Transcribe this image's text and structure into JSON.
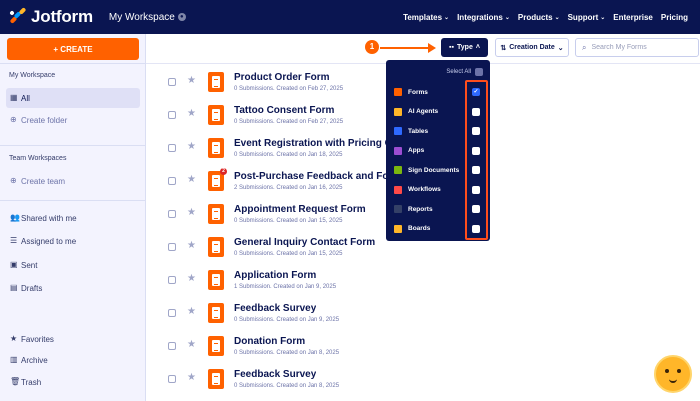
{
  "header": {
    "logo_text": "Jotform",
    "workspace_title": "My Workspace",
    "nav": [
      "Templates",
      "Integrations",
      "Products",
      "Support",
      "Enterprise",
      "Pricing"
    ]
  },
  "sidebar": {
    "create_label": "+ CREATE",
    "my_workspace_heading": "My Workspace",
    "all_label": "All",
    "create_folder_label": "Create folder",
    "team_heading": "Team Workspaces",
    "create_team_label": "Create team",
    "shared_label": "Shared with me",
    "assigned_label": "Assigned to me",
    "sent_label": "Sent",
    "drafts_label": "Drafts",
    "favorites_label": "Favorites",
    "archive_label": "Archive",
    "trash_label": "Trash"
  },
  "toolbar": {
    "type_label": "Type",
    "date_label": "Creation Date",
    "search_placeholder": "Search My Forms"
  },
  "annotation": {
    "step_number": "1"
  },
  "forms": [
    {
      "title": "Product Order Form",
      "meta": "0 Submissions. Created on Feb 27, 2025",
      "badge": ""
    },
    {
      "title": "Tattoo Consent Form",
      "meta": "0 Submissions. Created on Feb 27, 2025",
      "badge": ""
    },
    {
      "title": "Event Registration with Pricing Options",
      "meta": "0 Submissions. Created on Jan 18, 2025",
      "badge": ""
    },
    {
      "title": "Post-Purchase Feedback and Follow-Up",
      "meta": "2 Submissions. Created on Jan 16, 2025",
      "badge": "2"
    },
    {
      "title": "Appointment Request Form",
      "meta": "0 Submissions. Created on Jan 15, 2025",
      "badge": ""
    },
    {
      "title": "General Inquiry Contact Form",
      "meta": "0 Submissions. Created on Jan 15, 2025",
      "badge": ""
    },
    {
      "title": "Application Form",
      "meta": "1 Submission. Created on Jan 9, 2025",
      "badge": ""
    },
    {
      "title": "Feedback Survey",
      "meta": "0 Submissions. Created on Jan 9, 2025",
      "badge": ""
    },
    {
      "title": "Donation Form",
      "meta": "0 Submissions. Created on Jan 8, 2025",
      "badge": ""
    },
    {
      "title": "Feedback Survey",
      "meta": "0 Submissions. Created on Jan 8, 2025",
      "badge": ""
    }
  ],
  "type_dropdown": {
    "select_all_label": "Select All",
    "items": [
      {
        "label": "Forms",
        "checked": true,
        "icon": "forms-icon",
        "color": "#ff6100"
      },
      {
        "label": "AI Agents",
        "checked": false,
        "icon": "ai-agents-icon",
        "color": "#ffb629"
      },
      {
        "label": "Tables",
        "checked": false,
        "icon": "tables-icon",
        "color": "#2e69ff"
      },
      {
        "label": "Apps",
        "checked": false,
        "icon": "apps-icon",
        "color": "#9c4dd3"
      },
      {
        "label": "Sign Documents",
        "checked": false,
        "icon": "sign-documents-icon",
        "color": "#7bb60f"
      },
      {
        "label": "Workflows",
        "checked": false,
        "icon": "workflows-icon",
        "color": "#ff4948"
      },
      {
        "label": "Reports",
        "checked": false,
        "icon": "reports-icon",
        "color": "#344067"
      },
      {
        "label": "Boards",
        "checked": false,
        "icon": "boards-icon",
        "color": "#ffb629"
      }
    ]
  },
  "colors": {
    "header_bg": "#0a1551",
    "accent_orange": "#ff6100",
    "checkbox_blue": "#2e69ff",
    "highlight_red": "#ff4d1c"
  }
}
